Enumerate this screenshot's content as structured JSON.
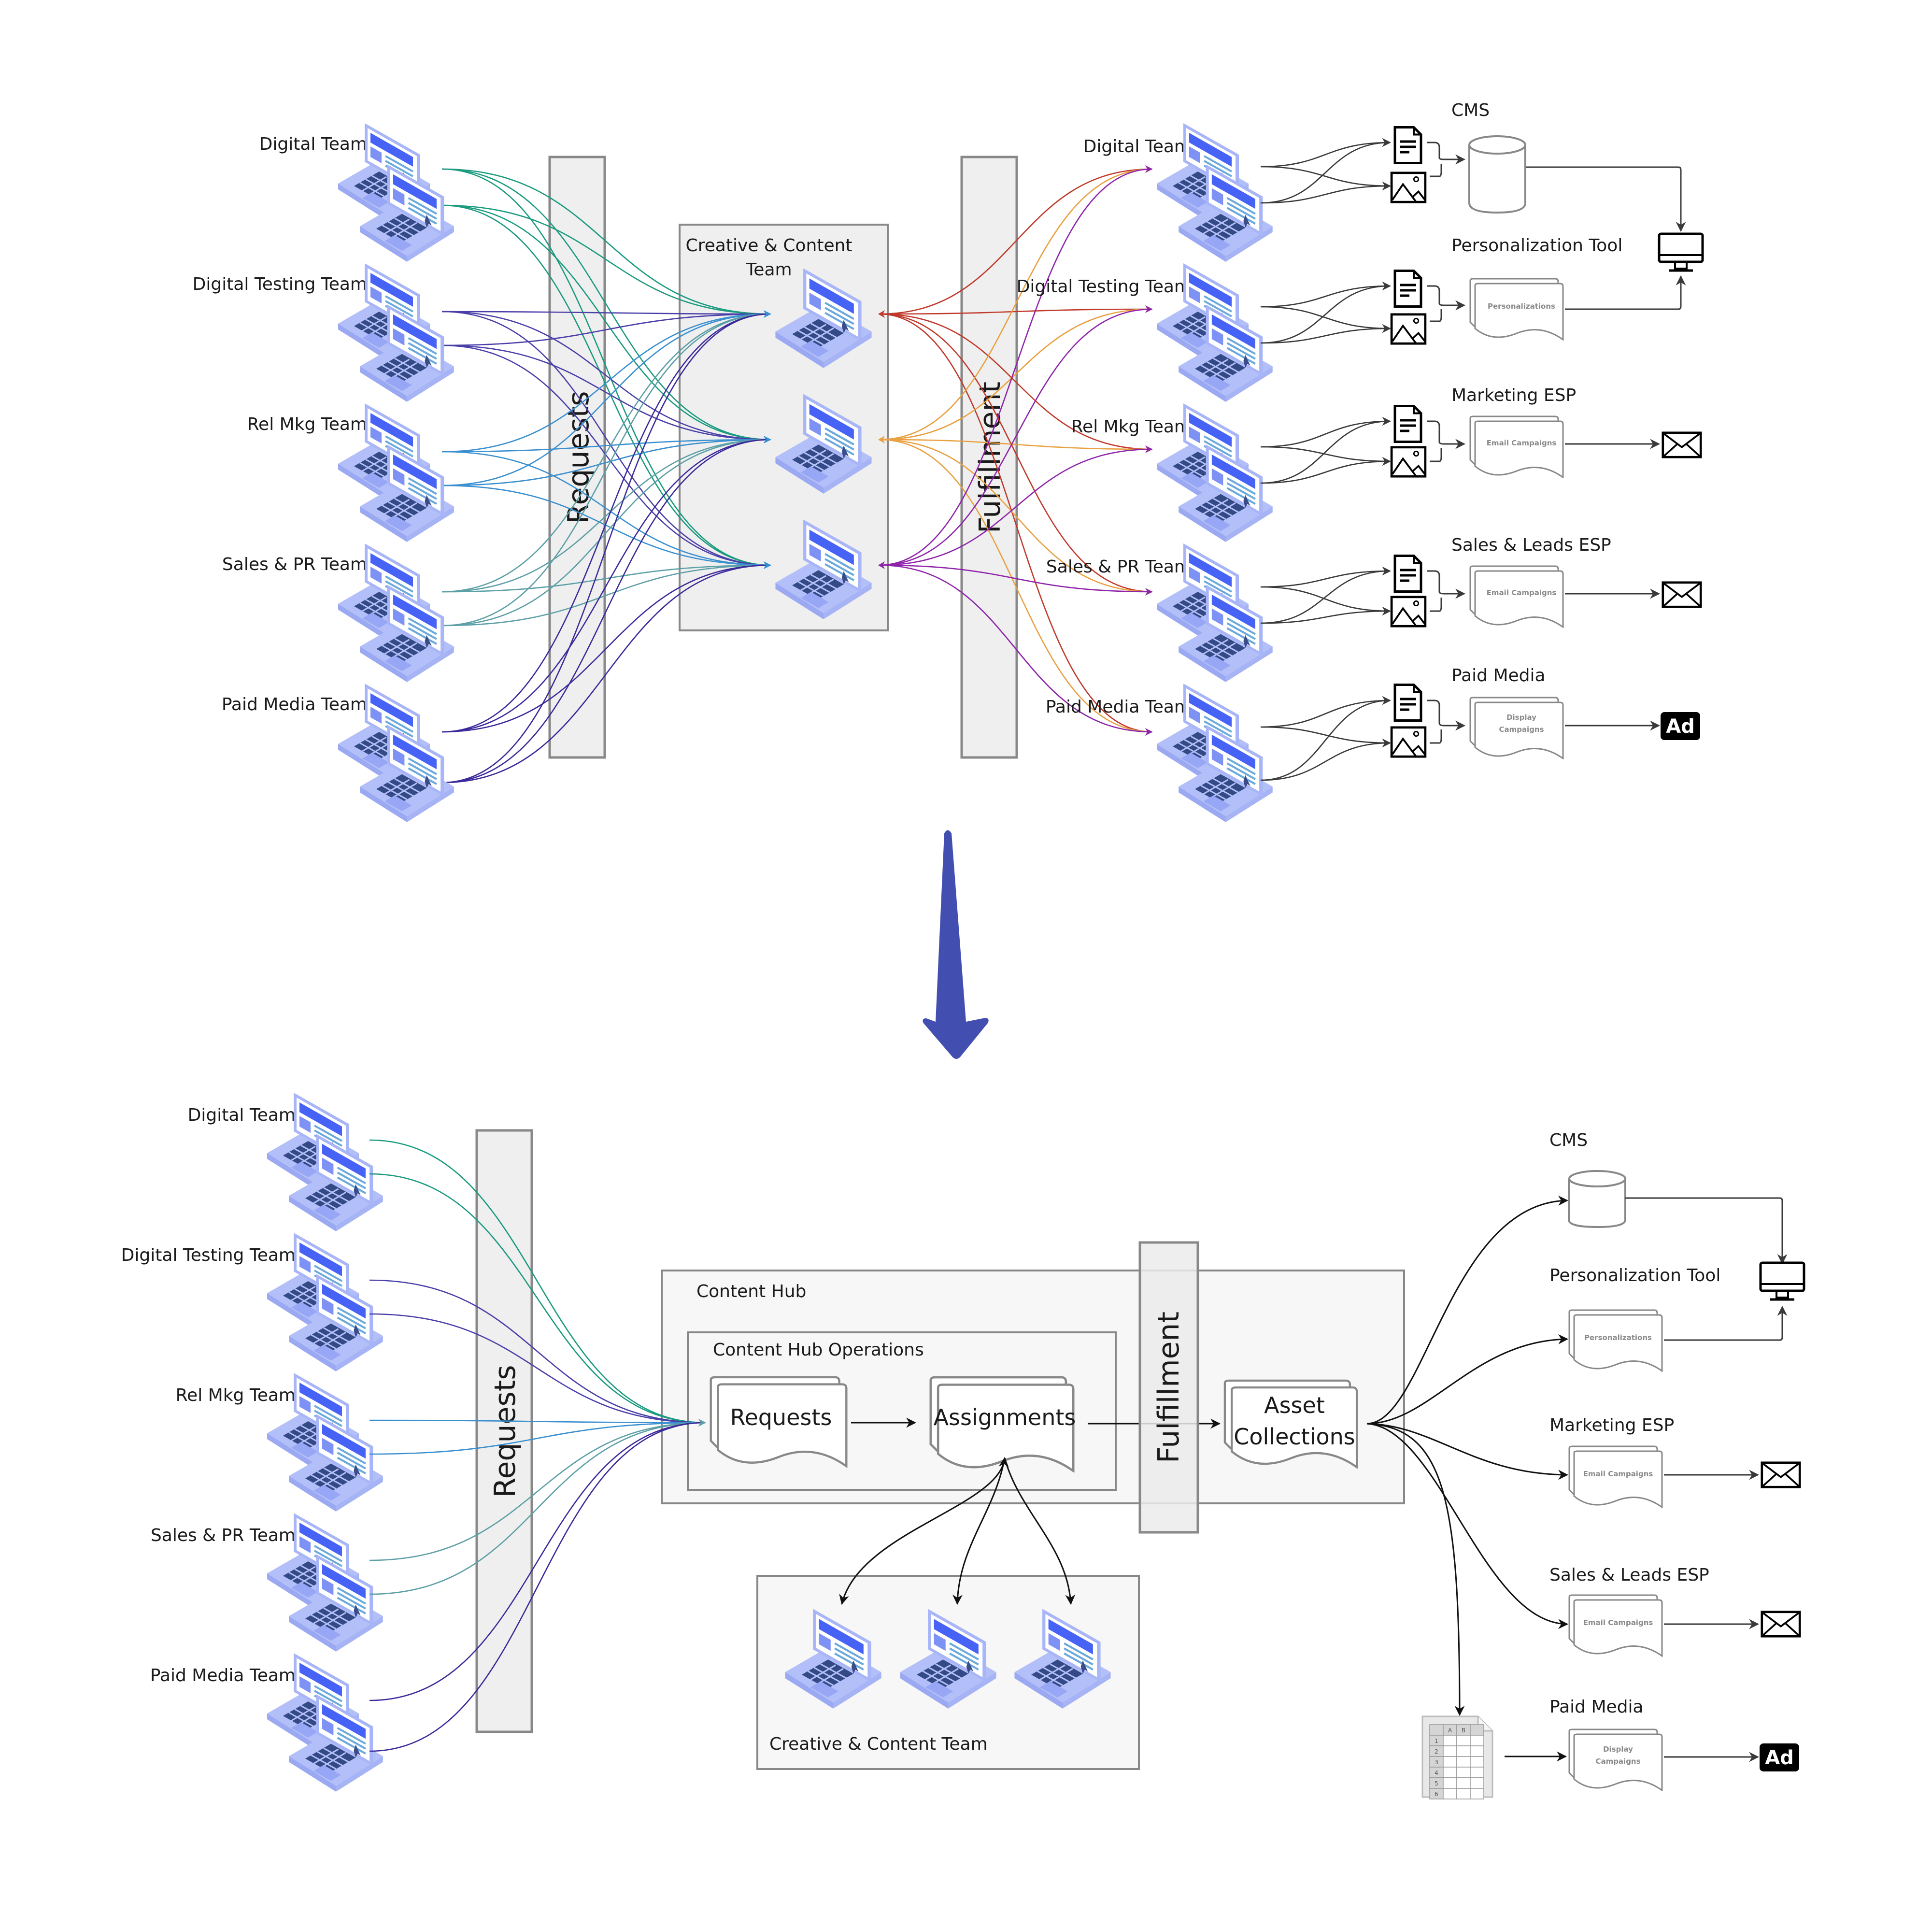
{
  "top": {
    "teams": [
      "Digital Team",
      "Digital Testing Team",
      "Rel Mkg Team",
      "Sales & PR Team",
      "Paid Media Team"
    ],
    "requests_label": "Requests",
    "fulfillment_label": "Fulfillment",
    "creative_box_label_line1": "Creative & Content",
    "creative_box_label_line2": "Team",
    "right_teams": [
      "Digital Team",
      "Digital Testing Team",
      "Rel Mkg Team",
      "Sales & PR Team",
      "Paid Media Team"
    ],
    "destinations": [
      {
        "title": "CMS",
        "artifact": "",
        "artifact_type": "database",
        "endpoint": "desktop-monitor"
      },
      {
        "title": "Personalization Tool",
        "artifact": "Personalizations",
        "artifact_type": "documents",
        "endpoint": "desktop-monitor"
      },
      {
        "title": "Marketing ESP",
        "artifact": "Email Campaigns",
        "artifact_type": "documents",
        "endpoint": "envelope"
      },
      {
        "title": "Sales & Leads ESP",
        "artifact": "Email Campaigns",
        "artifact_type": "documents",
        "endpoint": "envelope"
      },
      {
        "title": "Paid Media",
        "artifact_line1": "Display",
        "artifact_line2": "Campaigns",
        "artifact_type": "documents",
        "endpoint": "ad"
      }
    ],
    "request_line_colors": [
      "#1a9a7e",
      "#4a3fa8",
      "#3a8fcf",
      "#5c9fa6",
      "#3b2a9a"
    ],
    "fulfillment_line_colors": [
      "#c0392b",
      "#e8a040",
      "#8e24aa"
    ]
  },
  "transition_arrow_color": "#434fb0",
  "bottom": {
    "teams": [
      "Digital Team",
      "Digital Testing Team",
      "Rel Mkg Team",
      "Sales & PR Team",
      "Paid Media Team"
    ],
    "requests_label": "Requests",
    "fulfillment_label": "Fulfillment",
    "content_hub_label": "Content Hub",
    "content_hub_ops_label": "Content Hub Operations",
    "requests_doc": "Requests",
    "assignments_doc": "Assignments",
    "asset_collections_line1": "Asset",
    "asset_collections_line2": "Collections",
    "creative_team_label": "Creative & Content Team",
    "destinations": [
      {
        "title": "CMS"
      },
      {
        "title": "Personalization Tool",
        "artifact": "Personalizations"
      },
      {
        "title": "Marketing ESP",
        "artifact": "Email Campaigns"
      },
      {
        "title": "Sales & Leads ESP",
        "artifact": "Email Campaigns"
      },
      {
        "title": "Paid Media",
        "artifact_line1": "Display",
        "artifact_line2": "Campaigns"
      }
    ],
    "spreadsheet_cols": [
      "A",
      "B"
    ],
    "spreadsheet_rows": [
      "1",
      "2",
      "3",
      "4",
      "5",
      "6"
    ],
    "ad_label": "Ad"
  }
}
